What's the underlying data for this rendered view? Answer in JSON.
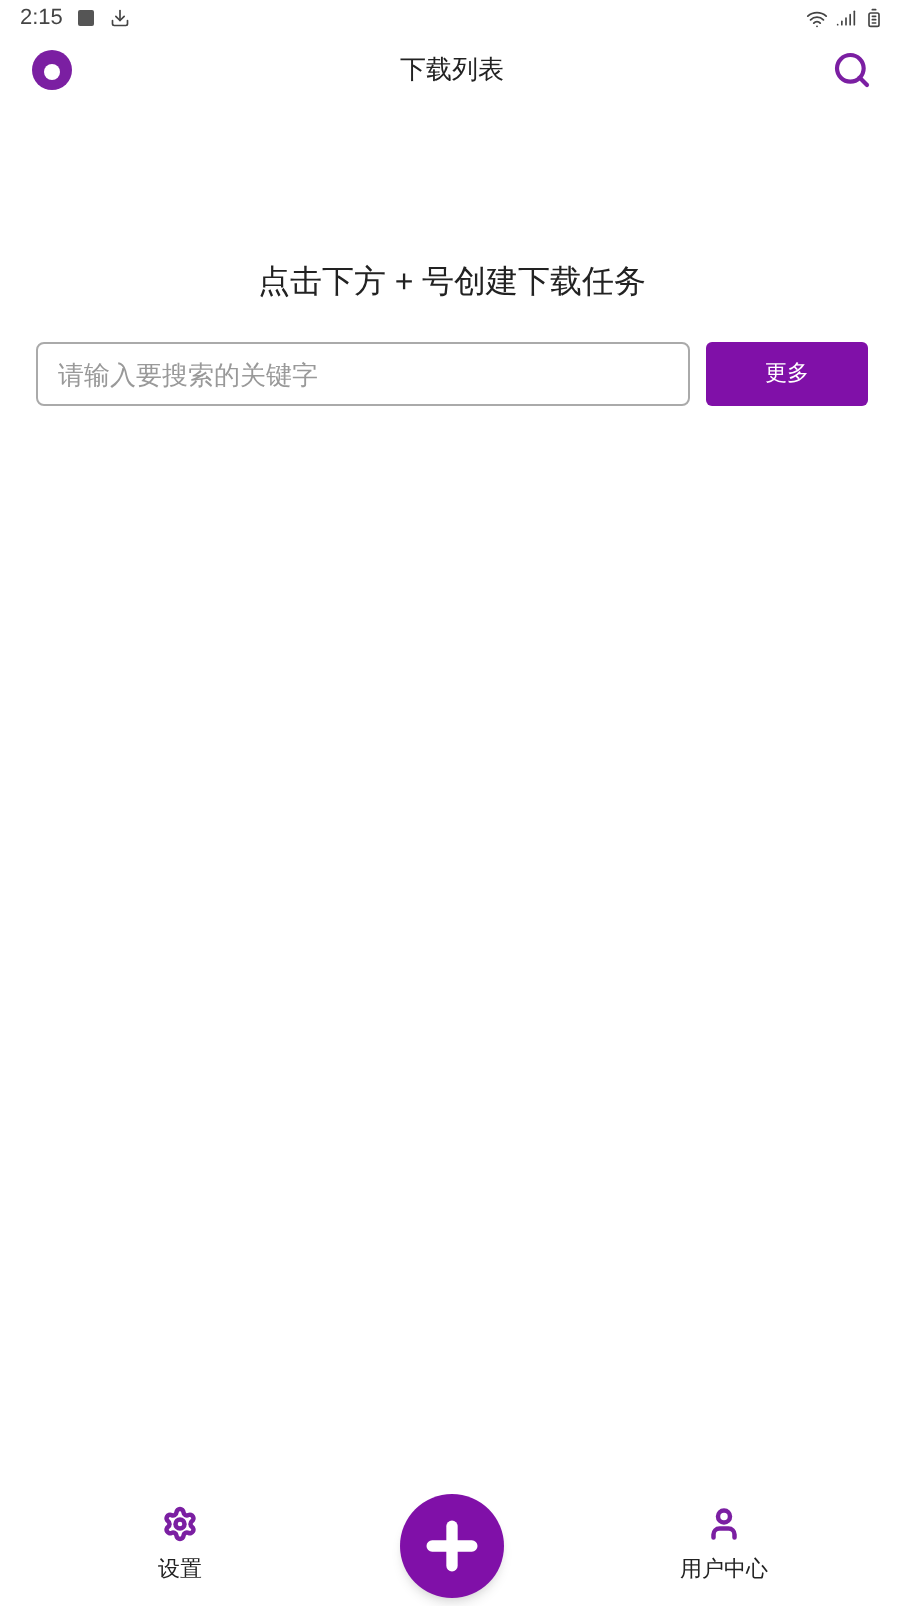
{
  "status_bar": {
    "time": "2:15"
  },
  "header": {
    "title": "下载列表"
  },
  "hint": "点击下方 + 号创建下载任务",
  "search": {
    "placeholder": "请输入要搜索的关键字",
    "button": "更多"
  },
  "bottom_nav": [
    {
      "kind": "settings",
      "label": "设置"
    },
    {
      "kind": "add"
    },
    {
      "kind": "user",
      "label": "用户中心"
    }
  ]
}
